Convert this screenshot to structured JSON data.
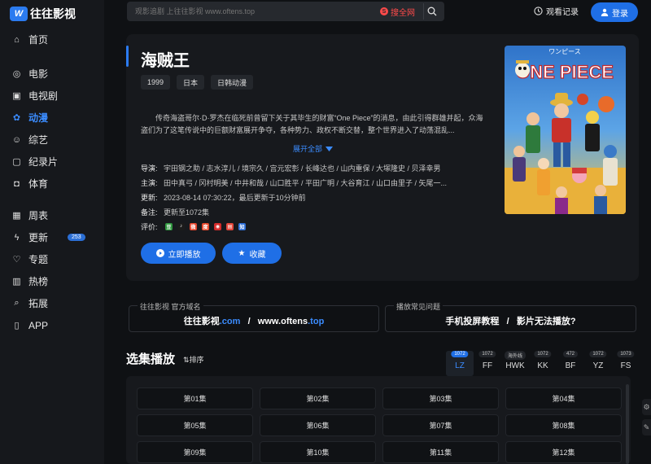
{
  "brand": {
    "mark": "W",
    "name": "往往影视"
  },
  "nav_top": [
    {
      "label": "首页",
      "icon": "home-icon",
      "glyph": "⌂"
    },
    {
      "label": "电影",
      "icon": "film-icon",
      "glyph": "◎"
    },
    {
      "label": "电视剧",
      "icon": "tv-icon",
      "glyph": "▣"
    },
    {
      "label": "动漫",
      "icon": "anime-icon",
      "glyph": "✿",
      "active": true
    },
    {
      "label": "综艺",
      "icon": "variety-icon",
      "glyph": "☺"
    },
    {
      "label": "纪录片",
      "icon": "documentary-icon",
      "glyph": "▢"
    },
    {
      "label": "体育",
      "icon": "sports-icon",
      "glyph": "◘"
    }
  ],
  "nav_bottom": [
    {
      "label": "周表",
      "icon": "calendar-icon",
      "glyph": "▦"
    },
    {
      "label": "更新",
      "icon": "bolt-icon",
      "glyph": "ϟ",
      "badge": "253"
    },
    {
      "label": "专题",
      "icon": "heart-icon",
      "glyph": "♡"
    },
    {
      "label": "热榜",
      "icon": "chart-icon",
      "glyph": "▥"
    },
    {
      "label": "拓展",
      "icon": "search-icon",
      "glyph": "⌕"
    },
    {
      "label": "APP",
      "icon": "app-icon",
      "glyph": "▯"
    }
  ],
  "search": {
    "placeholder": "观影追剧 上往往影视 www.oftens.top",
    "all_label": "搜全网"
  },
  "header": {
    "history_label": "观看记录",
    "login_label": "登录"
  },
  "detail": {
    "title": "海贼王",
    "tags": [
      "1999",
      "日本",
      "日韩动漫"
    ],
    "description": "传奇海盗哥尔·D·罗杰在临死前曾留下关于其毕生的财富“One Piece”的消息，由此引得群雄并起，众海盗们为了这笔传说中的巨额财富展开争夺，各种势力、政权不断交替，整个世界进入了动荡混乱...",
    "expand_label": "展开全部",
    "director_label": "导演:",
    "director": "宇田钢之助 / 志水淳儿 / 境宗久 / 宫元宏彰 / 长峰达也 / 山内重保 / 大塚隆史 / 贝泽幸男",
    "cast_label": "主演:",
    "cast": "田中真弓 / 冈村明美 / 中井和哉 / 山口胜平 / 平田广明 / 大谷育江 / 山口由里子 / 矢尾一...",
    "updated_label": "更新:",
    "updated": "2023-08-14 07:30:22，最后更新于10分钟前",
    "note_label": "备注:",
    "note": "更新至1072集",
    "rating_label": "评价:",
    "rating_sources": [
      {
        "icon": "douban-icon",
        "glyph": "豆",
        "color": "#2e963d"
      },
      {
        "icon": "tiktok-icon",
        "glyph": "♪",
        "color": "#1b1b1b"
      },
      {
        "icon": "weibo-icon",
        "glyph": "微",
        "color": "#e6452c"
      },
      {
        "icon": "baidu-icon",
        "glyph": "度",
        "color": "#e64a2e"
      },
      {
        "icon": "weibo-red-icon",
        "glyph": "◉",
        "color": "#d52c2c"
      },
      {
        "icon": "bilibili-icon",
        "glyph": "▤",
        "color": "#e2473b"
      },
      {
        "icon": "zhihu-icon",
        "glyph": "知",
        "color": "#2d6ed6"
      }
    ],
    "play_label": "立即播放",
    "fav_label": "收藏",
    "poster_title": "ONE PIECE",
    "poster_subtitle": "ワンピース"
  },
  "domains": {
    "official_label": "往往影视 官方域名",
    "official_name": "往往影视",
    "official_tld1": ".com",
    "official_sep": "/",
    "official_host": "www.oftens",
    "official_tld2": ".top",
    "faq_label": "播放常见问题",
    "faq_link1": "手机投屏教程",
    "faq_sep": "/",
    "faq_link2": "影片无法播放?"
  },
  "episodes_section": {
    "title": "选集播放",
    "sort_label": "⇅排序"
  },
  "sources": [
    {
      "name": "LZ",
      "count": "1072",
      "active": true
    },
    {
      "name": "FF",
      "count": "1072"
    },
    {
      "name": "HWK",
      "count": "海外线"
    },
    {
      "name": "KK",
      "count": "1072"
    },
    {
      "name": "BF",
      "count": "472"
    },
    {
      "name": "YZ",
      "count": "1072"
    },
    {
      "name": "FS",
      "count": "1073"
    }
  ],
  "episodes": [
    "第01集",
    "第02集",
    "第03集",
    "第04集",
    "第05集",
    "第06集",
    "第07集",
    "第08集",
    "第09集",
    "第10集",
    "第11集",
    "第12集"
  ],
  "colors": {
    "accent": "#1f6fe6",
    "highlight": "#3b8cff",
    "alert": "#ff4a4a"
  }
}
